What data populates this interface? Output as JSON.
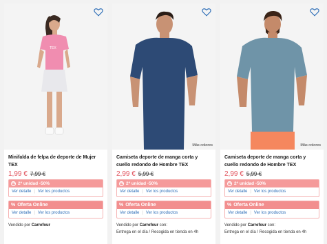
{
  "products": [
    {
      "title": "Minifalda de felpa de deporte de Mujer TEX",
      "price": "1,99 €",
      "old_price": "7,99 €",
      "more_colors": "",
      "promo_label": "2ª unidad -50%",
      "online_label": "Oferta Online",
      "link_detail": "Ver detalle",
      "link_products": "Ver los productos",
      "sold_by_label": "Vendido por",
      "seller": "Carrefour",
      "sold_suffix": "",
      "delivery": ""
    },
    {
      "title": "Camiseta deporte de manga corta y cuello redondo de Hombre TEX",
      "price": "2,99 €",
      "old_price": "5,99 €",
      "more_colors": "Más colores",
      "promo_label": "2ª unidad -50%",
      "online_label": "Oferta Online",
      "link_detail": "Ver detalle",
      "link_products": "Ver los productos",
      "sold_by_label": "Vendido por",
      "seller": "Carrefour",
      "sold_suffix": "con:",
      "delivery": "Entrega en el día /  Recogida en tienda en 4h"
    },
    {
      "title": "Camiseta deporte de manga corta y cuello redondo de Hombre TEX",
      "price": "2,99 €",
      "old_price": "5,99 €",
      "more_colors": "Más colores",
      "promo_label": "2ª unidad -50%",
      "online_label": "Oferta Online",
      "link_detail": "Ver detalle",
      "link_products": "Ver los productos",
      "sold_by_label": "Vendido por",
      "seller": "Carrefour",
      "sold_suffix": "con:",
      "delivery": "Entrega en el día /  Recogida en tienda en 4h"
    }
  ],
  "first_more_colors": "Más colores",
  "icons": {
    "favorite": "heart-outline-icon",
    "promo": "percent-circle-icon"
  },
  "colors": {
    "price": "#e0505a",
    "promo": "#f59a9a",
    "link": "#2f6fb8"
  }
}
